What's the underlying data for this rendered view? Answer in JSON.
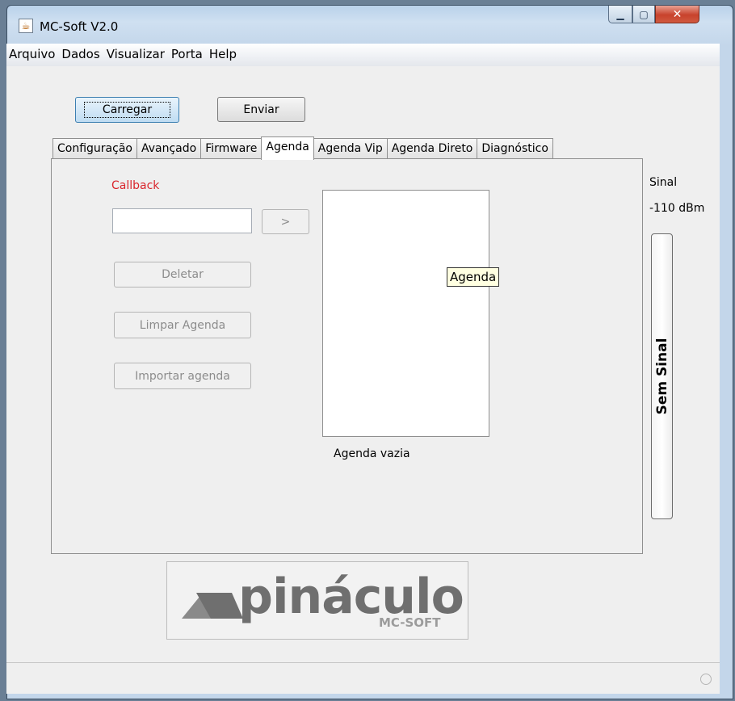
{
  "window": {
    "title": "MC-Soft V2.0"
  },
  "menu": [
    "Arquivo",
    "Dados",
    "Visualizar",
    "Porta",
    "Help"
  ],
  "toolbar": {
    "load_label": "Carregar",
    "send_label": "Enviar"
  },
  "tabs": [
    "Configuração",
    "Avançado",
    "Firmware",
    "Agenda",
    "Agenda Vip",
    "Agenda Direto",
    "Diagnóstico"
  ],
  "active_tab": "Agenda",
  "agenda": {
    "callback_label": "Callback",
    "callback_value": "",
    "go_label": ">",
    "delete_label": "Deletar",
    "clear_label": "Limpar Agenda",
    "import_label": "Importar agenda",
    "list_tooltip": "Agenda",
    "list_status": "Agenda vazia"
  },
  "signal": {
    "label": "Sinal",
    "dbm": "-110 dBm",
    "status": "Sem Sinal"
  },
  "logo": {
    "word": "pináculo",
    "sub": "MC-SOFT"
  },
  "colors": {
    "callback_label": "#d9242b",
    "window_frame": "#b9d1ea",
    "close_button": "#c8422c"
  },
  "icons": {
    "app": "java-icon",
    "minimize": "minimize-icon",
    "maximize": "maximize-icon",
    "close": "close-icon",
    "status": "status-circle-icon"
  }
}
